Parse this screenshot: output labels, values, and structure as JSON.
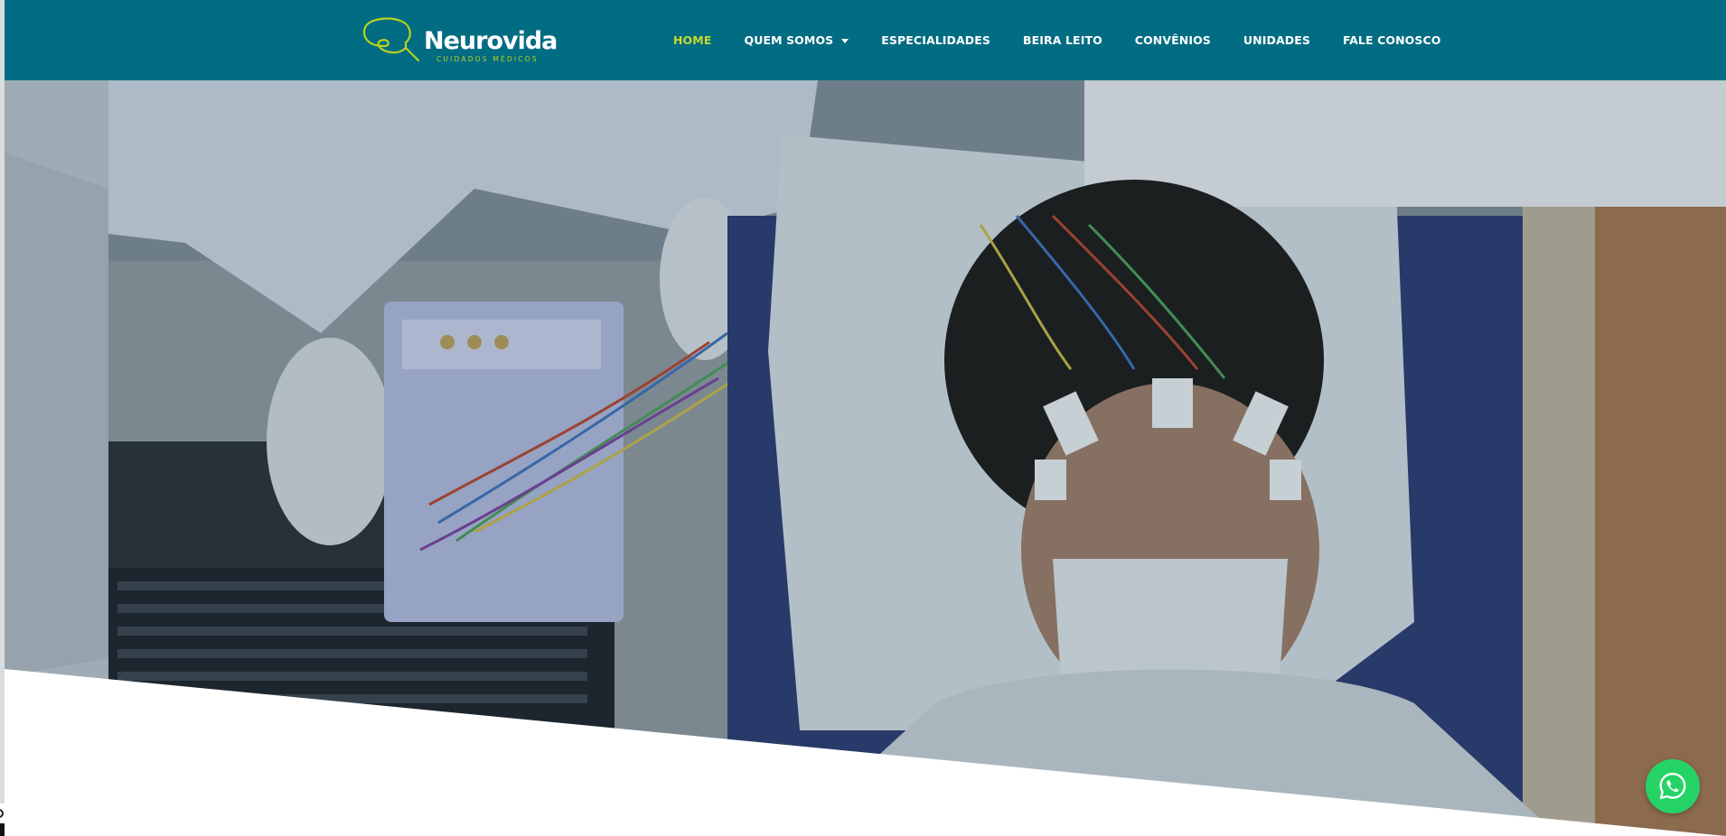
{
  "brand": {
    "name": "Neurovida",
    "tagline": "CUIDADOS MÉDICOS",
    "logo_accent": "#b9d11f"
  },
  "colors": {
    "header_bg": "#016c82",
    "nav_text": "#ffffff",
    "nav_active": "#c8d92a",
    "whatsapp": "#25d366"
  },
  "nav": {
    "items": [
      {
        "label": "HOME",
        "active": true
      },
      {
        "label": "QUEM SOMOS",
        "has_dropdown": true
      },
      {
        "label": "ESPECIALIDADES"
      },
      {
        "label": "BEIRA LEITO"
      },
      {
        "label": "CONVÊNIOS"
      },
      {
        "label": "UNIDADES"
      },
      {
        "label": "FALE CONOSCO"
      }
    ]
  },
  "hero": {
    "image_subject": "patient-eeg-exam-photo"
  },
  "floating": {
    "whatsapp_icon": "whatsapp-icon"
  }
}
